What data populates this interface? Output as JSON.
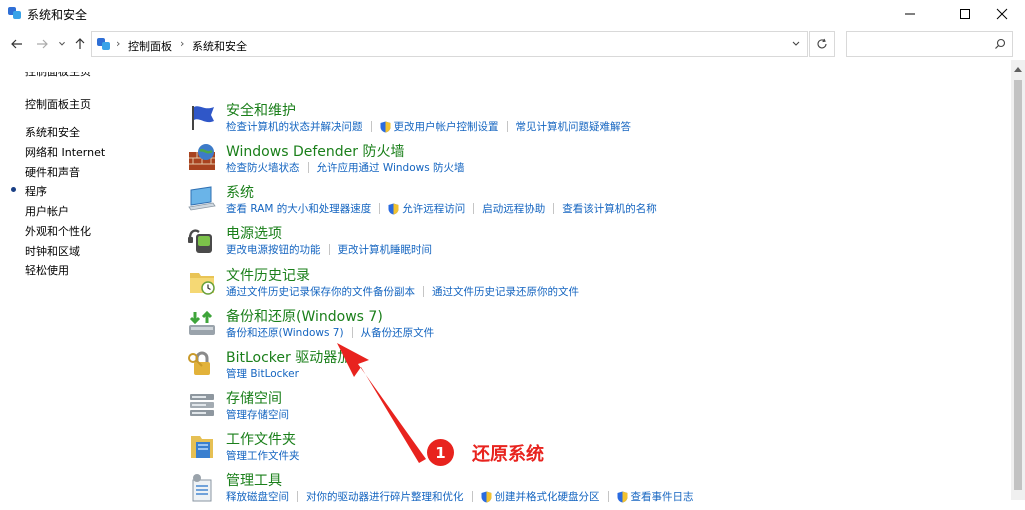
{
  "window": {
    "title": "系统和安全"
  },
  "address": {
    "crumbs": [
      "控制面板",
      "系统和安全"
    ],
    "search_placeholder": ""
  },
  "sidebar": {
    "cut_item": "控制面板主页",
    "items": [
      {
        "label": "控制面板主页",
        "selected": false
      },
      {
        "label": "系统和安全",
        "selected": true
      },
      {
        "label": "网络和 Internet",
        "selected": false
      },
      {
        "label": "硬件和声音",
        "selected": false
      },
      {
        "label": "程序",
        "selected": false
      },
      {
        "label": "用户帐户",
        "selected": false
      },
      {
        "label": "外观和个性化",
        "selected": false
      },
      {
        "label": "时钟和区域",
        "selected": false
      },
      {
        "label": "轻松使用",
        "selected": false
      }
    ]
  },
  "categories": [
    {
      "title": "安全和维护",
      "icon": "flag-icon",
      "links": [
        {
          "text": "检查计算机的状态并解决问题",
          "shield": false
        },
        {
          "text": "更改用户帐户控制设置",
          "shield": true
        },
        {
          "text": "常见计算机问题疑难解答",
          "shield": false
        }
      ]
    },
    {
      "title": "Windows Defender 防火墙",
      "icon": "firewall-icon",
      "links": [
        {
          "text": "检查防火墙状态",
          "shield": false
        },
        {
          "text": "允许应用通过 Windows 防火墙",
          "shield": false
        }
      ]
    },
    {
      "title": "系统",
      "icon": "system-icon",
      "links": [
        {
          "text": "查看 RAM 的大小和处理器速度",
          "shield": false
        },
        {
          "text": "允许远程访问",
          "shield": true
        },
        {
          "text": "启动远程协助",
          "shield": false
        },
        {
          "text": "查看该计算机的名称",
          "shield": false
        }
      ]
    },
    {
      "title": "电源选项",
      "icon": "power-icon",
      "links": [
        {
          "text": "更改电源按钮的功能",
          "shield": false
        },
        {
          "text": "更改计算机睡眠时间",
          "shield": false
        }
      ]
    },
    {
      "title": "文件历史记录",
      "icon": "file-history-icon",
      "links": [
        {
          "text": "通过文件历史记录保存你的文件备份副本",
          "shield": false
        },
        {
          "text": "通过文件历史记录还原你的文件",
          "shield": false
        }
      ]
    },
    {
      "title": "备份和还原(Windows 7)",
      "icon": "backup-icon",
      "links": [
        {
          "text": "备份和还原(Windows 7)",
          "shield": false
        },
        {
          "text": "从备份还原文件",
          "shield": false
        }
      ]
    },
    {
      "title": "BitLocker 驱动器加",
      "icon": "bitlocker-icon",
      "links": [
        {
          "text": "管理 BitLocker",
          "shield": false
        }
      ]
    },
    {
      "title": "存储空间",
      "icon": "storage-icon",
      "links": [
        {
          "text": "管理存储空间",
          "shield": false
        }
      ]
    },
    {
      "title": "工作文件夹",
      "icon": "work-folder-icon",
      "links": [
        {
          "text": "管理工作文件夹",
          "shield": false
        }
      ]
    },
    {
      "title": "管理工具",
      "icon": "admin-tools-icon",
      "links": [
        {
          "text": "释放磁盘空间",
          "shield": false
        },
        {
          "text": "对你的驱动器进行碎片整理和优化",
          "shield": false
        },
        {
          "text": "创建并格式化硬盘分区",
          "shield": true
        },
        {
          "text": "查看事件日志",
          "shield": true
        }
      ]
    }
  ],
  "annotation": {
    "badge": "1",
    "text": "还原系统",
    "color": "#e8231e"
  }
}
